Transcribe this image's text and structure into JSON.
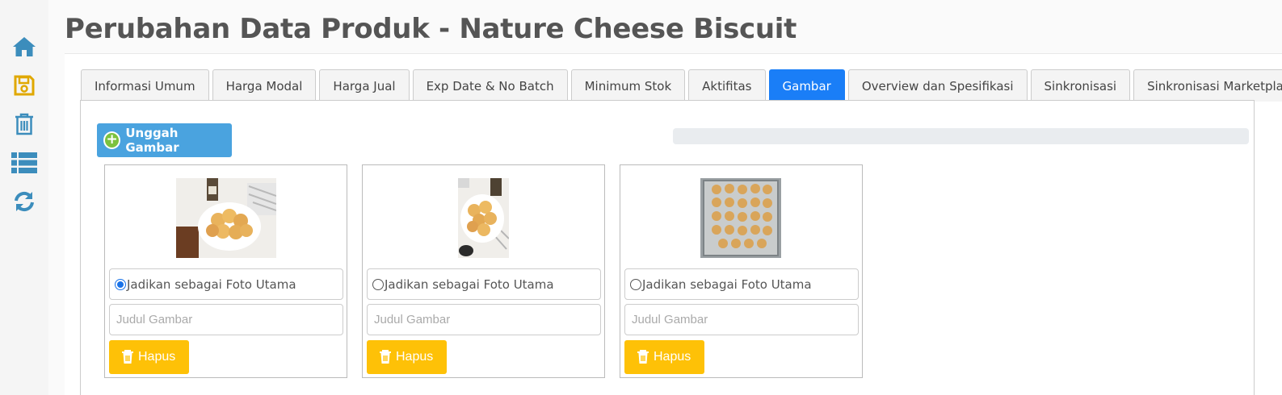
{
  "page": {
    "title": "Perubahan Data Produk - Nature Cheese Biscuit"
  },
  "sidebar": {
    "icons": [
      "home-icon",
      "save-icon",
      "trash-icon",
      "list-icon",
      "refresh-icon"
    ],
    "color": "#3c8dbc",
    "save_color": "#e0a800"
  },
  "tabs": [
    {
      "label": "Informasi Umum"
    },
    {
      "label": "Harga Modal"
    },
    {
      "label": "Harga Jual"
    },
    {
      "label": "Exp Date & No Batch"
    },
    {
      "label": "Minimum Stok"
    },
    {
      "label": "Aktifitas"
    },
    {
      "label": "Gambar",
      "active": true
    },
    {
      "label": "Overview dan Spesifikasi"
    },
    {
      "label": "Sinkronisasi"
    },
    {
      "label": "Sinkronisasi Marketplace"
    }
  ],
  "upload": {
    "label": "Unggah Gambar",
    "icon": "plus-circle-icon",
    "color": "#4aa3df"
  },
  "images": [
    {
      "main_label": "Jadikan sebagai Foto Utama",
      "is_main": true,
      "title_placeholder": "Judul Gambar",
      "title_value": "",
      "delete_label": "Hapus"
    },
    {
      "main_label": "Jadikan sebagai Foto Utama",
      "is_main": false,
      "title_placeholder": "Judul Gambar",
      "title_value": "",
      "delete_label": "Hapus"
    },
    {
      "main_label": "Jadikan sebagai Foto Utama",
      "is_main": false,
      "title_placeholder": "Judul Gambar",
      "title_value": "",
      "delete_label": "Hapus"
    }
  ],
  "colors": {
    "active_tab": "#1a7ef7",
    "delete_button": "#fec107"
  }
}
